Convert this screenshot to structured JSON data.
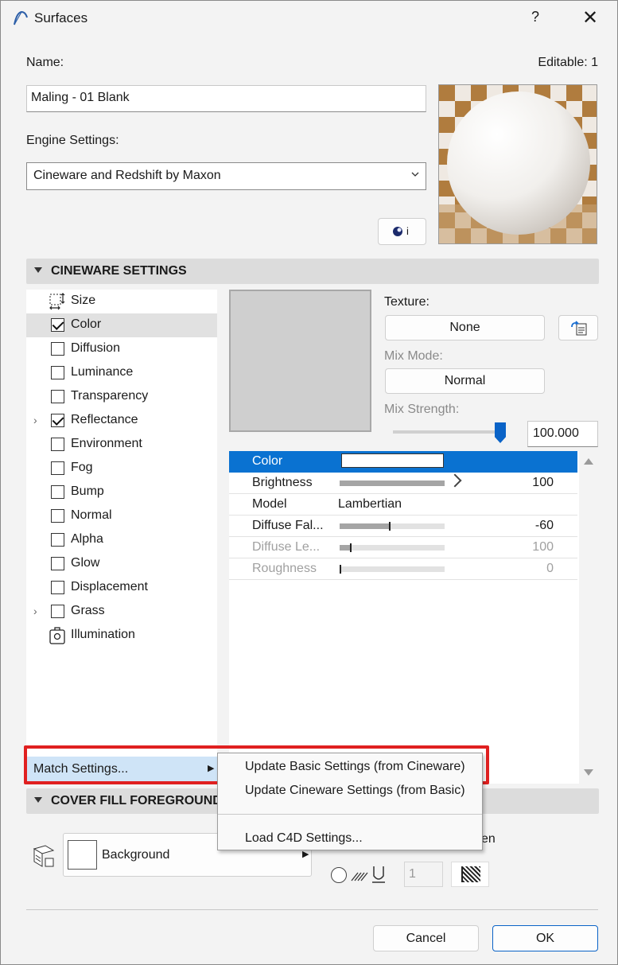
{
  "window": {
    "title": "Surfaces",
    "help": "?",
    "close": "✕"
  },
  "name_label": "Name:",
  "editable": "Editable: 1",
  "name_value": "Maling - 01 Blank",
  "engine_label": "Engine Settings:",
  "engine_value": "Cineware and Redshift by Maxon",
  "info_button": "i",
  "cineware_header": "CINEWARE SETTINGS",
  "channels": [
    {
      "label": "Size",
      "type": "icon"
    },
    {
      "label": "Color",
      "type": "check",
      "checked": true,
      "selected": true
    },
    {
      "label": "Diffusion",
      "type": "check"
    },
    {
      "label": "Luminance",
      "type": "check"
    },
    {
      "label": "Transparency",
      "type": "check"
    },
    {
      "label": "Reflectance",
      "type": "check",
      "checked": true,
      "expand": true
    },
    {
      "label": "Environment",
      "type": "check"
    },
    {
      "label": "Fog",
      "type": "check"
    },
    {
      "label": "Bump",
      "type": "check"
    },
    {
      "label": "Normal",
      "type": "check"
    },
    {
      "label": "Alpha",
      "type": "check"
    },
    {
      "label": "Glow",
      "type": "check"
    },
    {
      "label": "Displacement",
      "type": "check"
    },
    {
      "label": "Grass",
      "type": "check",
      "expand": true
    },
    {
      "label": "Illumination",
      "type": "icon"
    }
  ],
  "texture_label": "Texture:",
  "texture_value": "None",
  "mixmode_label": "Mix Mode:",
  "mixmode_value": "Normal",
  "mixstrength_label": "Mix Strength:",
  "mixstrength_value": "100.000",
  "mixstrength_fraction": 1.0,
  "props": [
    {
      "name": "Color",
      "value": "",
      "selected": true
    },
    {
      "name": "Brightness",
      "value": "100",
      "fraction": 1.0
    },
    {
      "name": "Model",
      "value": "Lambertian"
    },
    {
      "name": "Diffuse Fal...",
      "value": "-60",
      "fraction": 0.47
    },
    {
      "name": "Diffuse Le...",
      "value": "100",
      "fraction": 0.1,
      "disabled": true
    },
    {
      "name": "Roughness",
      "value": "0",
      "fraction": 0.0,
      "disabled": true
    }
  ],
  "match_settings": "Match Settings...",
  "menu": {
    "item1": "Update Basic Settings (from Cineware)",
    "item2": "Update Cineware Settings (from Basic)",
    "item3": "Load C4D Settings..."
  },
  "cover_header": "COVER FILL FOREGROUND",
  "background_label": "Background",
  "partial_text": "en",
  "pen_value": "1",
  "cancel": "Cancel",
  "ok": "OK"
}
